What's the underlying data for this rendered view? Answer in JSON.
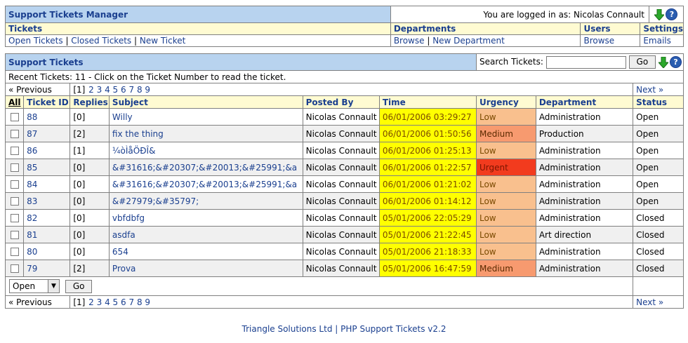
{
  "header": {
    "title": "Support Tickets Manager",
    "logged_in_text": "You are logged in as: Nicolas Connault"
  },
  "menu": {
    "tickets": {
      "label": "Tickets",
      "links": [
        "Open Tickets",
        "Closed Tickets",
        "New Ticket"
      ]
    },
    "departments": {
      "label": "Departments",
      "links": [
        "Browse",
        "New Department"
      ]
    },
    "users": {
      "label": "Users",
      "links": [
        "Browse"
      ]
    },
    "settings": {
      "label": "Settings",
      "links": [
        "Emails"
      ]
    }
  },
  "panel": {
    "title": "Support Tickets",
    "search_label": "Search Tickets:",
    "search_value": "",
    "go_label": "Go",
    "recent_text": "Recent Tickets: 11 - Click on the Ticket Number to read the ticket."
  },
  "pagination": {
    "previous": "« Previous",
    "next": "Next »",
    "current": "[1]",
    "pages": [
      "2",
      "3",
      "4",
      "5",
      "6",
      "7",
      "8",
      "9"
    ]
  },
  "columns": [
    "All",
    "Ticket ID",
    "Replies",
    "Subject",
    "Posted By",
    "Time",
    "Urgency",
    "Department",
    "Status"
  ],
  "tickets": [
    {
      "id": "88",
      "replies": "[0]",
      "subject": "Willy",
      "posted_by": "Nicolas Connault",
      "time": "06/01/2006 03:29:27",
      "urgency": "Low",
      "department": "Administration",
      "status": "Open"
    },
    {
      "id": "87",
      "replies": "[2]",
      "subject": "fix the thing",
      "posted_by": "Nicolas Connault",
      "time": "06/01/2006 01:50:56",
      "urgency": "Medium",
      "department": "Production",
      "status": "Open"
    },
    {
      "id": "86",
      "replies": "[1]",
      "subject": "¼òÌåÖÐÎ&",
      "posted_by": "Nicolas Connault",
      "time": "06/01/2006 01:25:13",
      "urgency": "Low",
      "department": "Administration",
      "status": "Open"
    },
    {
      "id": "85",
      "replies": "[0]",
      "subject": "&#31616;&#20307;&#20013;&#25991;&a",
      "posted_by": "Nicolas Connault",
      "time": "06/01/2006 01:22:57",
      "urgency": "Urgent",
      "department": "Administration",
      "status": "Open"
    },
    {
      "id": "84",
      "replies": "[0]",
      "subject": "&#31616;&#20307;&#20013;&#25991;&a",
      "posted_by": "Nicolas Connault",
      "time": "06/01/2006 01:21:02",
      "urgency": "Low",
      "department": "Administration",
      "status": "Open"
    },
    {
      "id": "83",
      "replies": "[0]",
      "subject": "&#27979;&#35797;",
      "posted_by": "Nicolas Connault",
      "time": "06/01/2006 01:14:12",
      "urgency": "Low",
      "department": "Administration",
      "status": "Open"
    },
    {
      "id": "82",
      "replies": "[0]",
      "subject": "vbfdbfg",
      "posted_by": "Nicolas Connault",
      "time": "05/01/2006 22:05:29",
      "urgency": "Low",
      "department": "Administration",
      "status": "Closed"
    },
    {
      "id": "81",
      "replies": "[0]",
      "subject": "asdfa",
      "posted_by": "Nicolas Connault",
      "time": "05/01/2006 21:22:45",
      "urgency": "Low",
      "department": "Art direction",
      "status": "Closed"
    },
    {
      "id": "80",
      "replies": "[0]",
      "subject": "654",
      "posted_by": "Nicolas Connault",
      "time": "05/01/2006 21:18:33",
      "urgency": "Low",
      "department": "Administration",
      "status": "Closed"
    },
    {
      "id": "79",
      "replies": "[2]",
      "subject": "Prova",
      "posted_by": "Nicolas Connault",
      "time": "05/01/2006 16:47:59",
      "urgency": "Medium",
      "department": "Administration",
      "status": "Closed"
    }
  ],
  "action": {
    "select_value": "Open",
    "go_label": "Go"
  },
  "footer": {
    "company": "Triangle Solutions Ltd",
    "separator": "|",
    "product": "PHP Support Tickets v2.2"
  },
  "icons": {
    "download": "arrow-down-icon",
    "help": "help-icon"
  },
  "colors": {
    "header_blue": "#b8d3ef",
    "cream": "#fffbd2",
    "time_yellow": "#ffff00",
    "urgency_low": "#f9c08e",
    "urgency_medium": "#f79a6f",
    "urgency_urgent": "#f23b1e"
  }
}
